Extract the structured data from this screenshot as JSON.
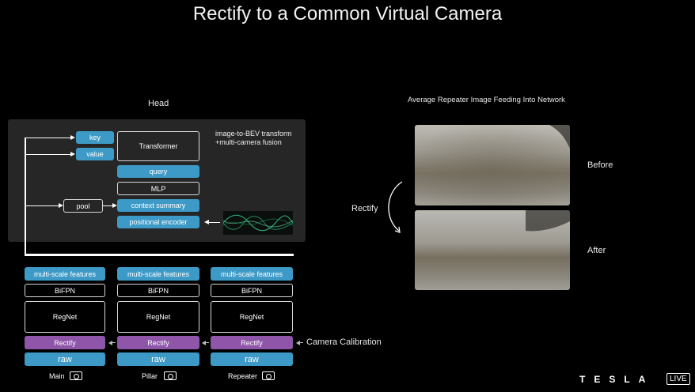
{
  "slide": {
    "title": "Rectify to a Common Virtual Camera"
  },
  "left": {
    "head_label": "Head",
    "fusion_note": [
      "image-to-BEV transform",
      "+multi-camera fusion"
    ],
    "blocks": {
      "key": "key",
      "value": "value",
      "transformer": "Transformer",
      "query": "query",
      "mlp": "MLP",
      "pool": "pool",
      "context_summary": "context summary",
      "positional_encoder": "positional encoder"
    },
    "columns": [
      {
        "msf": "multi-scale features",
        "bifpn": "BiFPN",
        "regnet": "RegNet",
        "rectify": "Rectify",
        "raw": "raw",
        "camera": "Main"
      },
      {
        "msf": "multi-scale features",
        "bifpn": "BiFPN",
        "regnet": "RegNet",
        "rectify": "Rectify",
        "raw": "raw",
        "camera": "Pillar"
      },
      {
        "msf": "multi-scale features",
        "bifpn": "BiFPN",
        "regnet": "RegNet",
        "rectify": "Rectify",
        "raw": "raw",
        "camera": "Repeater"
      }
    ],
    "camera_calibration": "Camera Calibration"
  },
  "right": {
    "heading": "Average Repeater Image Feeding Into Network",
    "before": "Before",
    "after": "After",
    "rectify": "Rectify"
  },
  "brand": {
    "logo": "TESLA",
    "live": "LIVE"
  },
  "colors": {
    "blue": "#3d9ac6",
    "purple": "#8e55a8",
    "panel": "#262626"
  }
}
